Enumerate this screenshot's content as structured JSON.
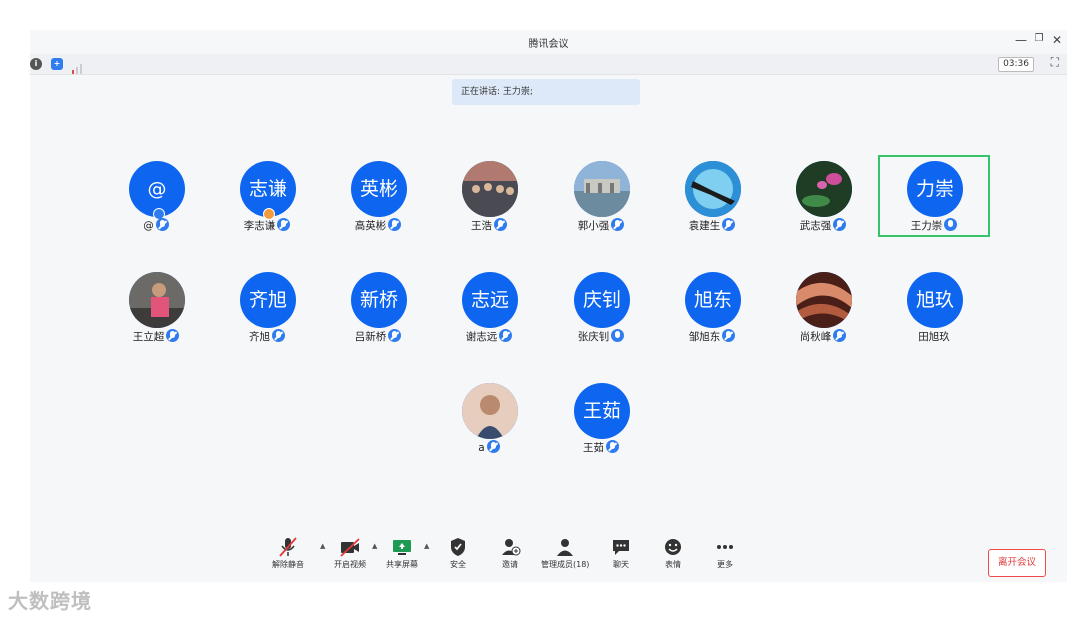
{
  "window": {
    "title": "腾讯会议",
    "timer": "03:36"
  },
  "speaking": "正在讲话: 王力崇;",
  "participants": [
    {
      "avatar_text": "@",
      "name": "@"
    },
    {
      "avatar_text": "志谦",
      "name": "李志谦"
    },
    {
      "avatar_text": "英彬",
      "name": "高英彬"
    },
    {
      "avatar_text": "",
      "name": "王浩"
    },
    {
      "avatar_text": "",
      "name": "郭小强"
    },
    {
      "avatar_text": "",
      "name": "袁建生"
    },
    {
      "avatar_text": "",
      "name": "武志强"
    },
    {
      "avatar_text": "力崇",
      "name": "王力崇"
    },
    {
      "avatar_text": "",
      "name": "王立超"
    },
    {
      "avatar_text": "齐旭",
      "name": "齐旭"
    },
    {
      "avatar_text": "新桥",
      "name": "吕新桥"
    },
    {
      "avatar_text": "志远",
      "name": "谢志远"
    },
    {
      "avatar_text": "庆钊",
      "name": "张庆钊"
    },
    {
      "avatar_text": "旭东",
      "name": "邹旭东"
    },
    {
      "avatar_text": "",
      "name": "尚秋峰"
    },
    {
      "avatar_text": "旭玖",
      "name": "田旭玖"
    },
    {
      "avatar_text": "",
      "name": "a"
    },
    {
      "avatar_text": "王茹",
      "name": "王茹"
    }
  ],
  "toolbar": {
    "unmute": "解除静音",
    "start_video": "开启视频",
    "share_screen": "共享屏幕",
    "security": "安全",
    "invite": "邀请",
    "manage_members": "管理成员(18)",
    "chat": "聊天",
    "reactions": "表情",
    "more": "更多",
    "leave": "离开会议"
  },
  "watermark": "大数跨境",
  "colors": {
    "accent": "#0e66f0",
    "leave": "#e03a3a",
    "highlight": "#36c36a"
  }
}
